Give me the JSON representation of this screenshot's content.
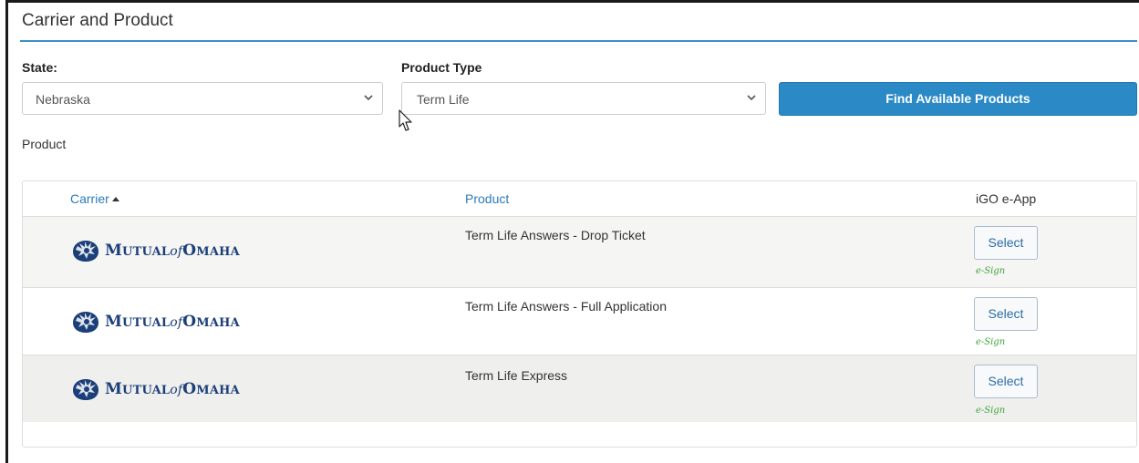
{
  "section": {
    "title": "Carrier and Product"
  },
  "form": {
    "state_label": "State:",
    "state_value": "Nebraska",
    "product_type_label": "Product Type",
    "product_type_value": "Term Life",
    "find_button": "Find Available Products"
  },
  "product_label": "Product",
  "table": {
    "headers": {
      "carrier": "Carrier",
      "product": "Product",
      "igo": "iGO e-App"
    },
    "sort": {
      "column": "carrier",
      "direction": "ascending"
    },
    "rows": [
      {
        "carrier": "Mutual of Omaha",
        "product": "Term Life Answers - Drop Ticket",
        "action": "Select",
        "esign": "e-Sign"
      },
      {
        "carrier": "Mutual of Omaha",
        "product": "Term Life Answers - Full Application",
        "action": "Select",
        "esign": "e-Sign"
      },
      {
        "carrier": "Mutual of Omaha",
        "product": "Term Life Express",
        "action": "Select",
        "esign": "e-Sign"
      }
    ]
  },
  "colors": {
    "accent": "#2b8ac6",
    "link": "#2b7bb9",
    "esign": "#3fa53a",
    "logo": "#1c3f7a"
  },
  "icons": {
    "dropdown": "chevron-down-icon",
    "sort": "sort-ascending-icon",
    "logo": "lion-head-icon"
  }
}
